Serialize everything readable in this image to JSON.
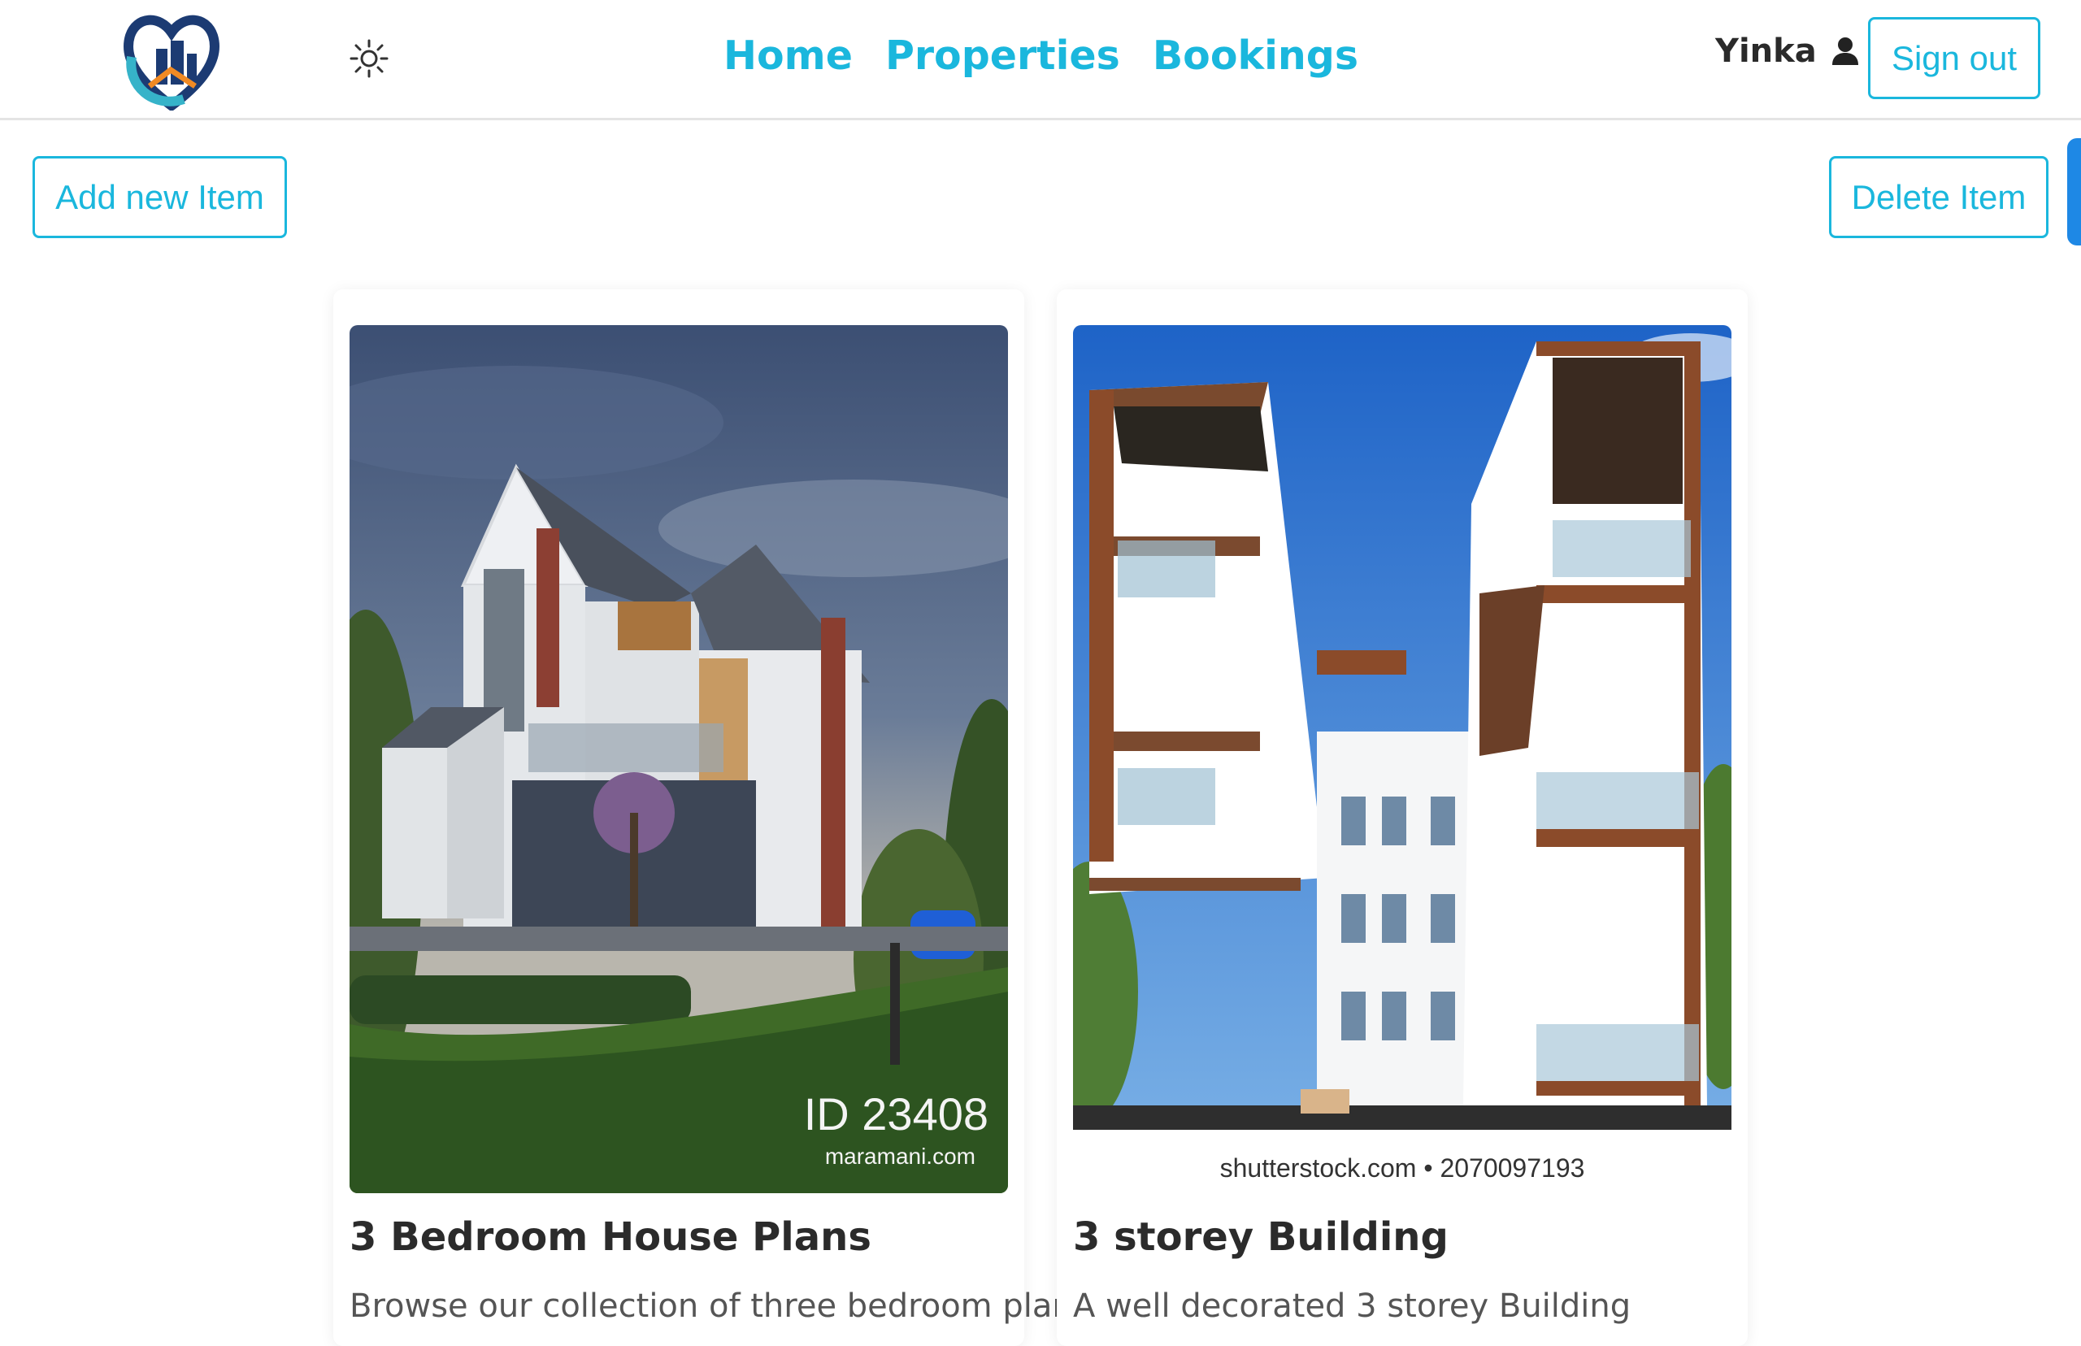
{
  "nav": {
    "links": [
      "Home",
      "Properties",
      "Bookings"
    ],
    "user_name": "Yinka",
    "sign_out": "Sign out",
    "icons": {
      "logo": "house-heart-logo",
      "theme": "sun-icon",
      "user": "user-icon"
    }
  },
  "toolbar": {
    "add_label": "Add new Item",
    "delete_label": "Delete Item"
  },
  "properties": [
    {
      "title": "3 Bedroom House Plans",
      "text": "Browse our collection of three bedroom plans",
      "watermark_id": "ID 23408",
      "watermark_site": "maramani.com"
    },
    {
      "title": "3 storey Building",
      "text": "A well decorated 3 storey Building",
      "watermark": "shutterstock.com • 2070097193"
    }
  ],
  "colors": {
    "accent": "#1ab7dd",
    "text": "#2b2b2b",
    "edge_tab": "#1e88e5"
  }
}
